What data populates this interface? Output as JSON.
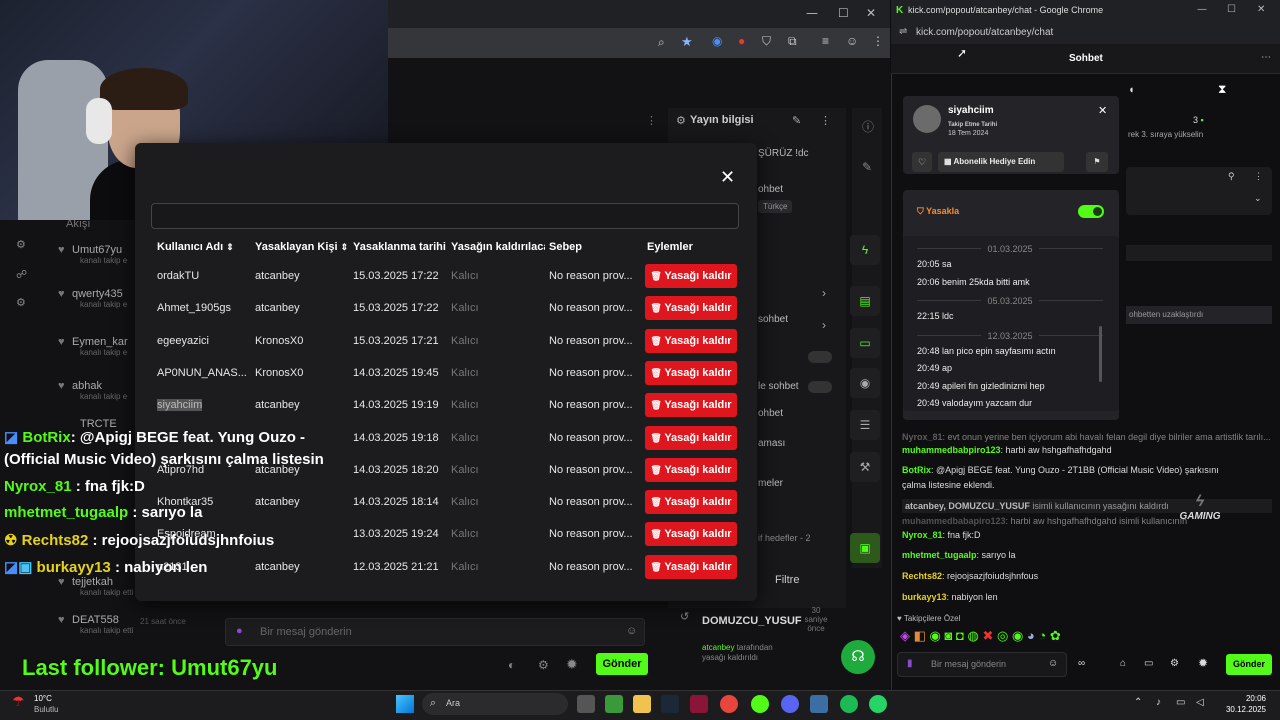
{
  "left_browser": {
    "window_controls": [
      "—",
      "☐",
      "✕"
    ]
  },
  "left_sidebar": {
    "heading": "Akışı",
    "items": [
      {
        "name": "Umut67yu",
        "sub": "kanalı takip e"
      },
      {
        "name": "qwerty435",
        "sub": "kanalı takip e"
      },
      {
        "name": "Eymen_kar",
        "sub": "kanalı takip e"
      },
      {
        "name": "abhak",
        "sub": "kanalı takip e"
      },
      {
        "name": "TRCTE",
        "sub": ""
      },
      {
        "name": "tejjetkah",
        "sub": "kanalı takip etti"
      },
      {
        "name": "DEAT558",
        "sub": "kanalı takip etti"
      }
    ],
    "deat_time": "21 saat önce"
  },
  "stream_info": {
    "heading": "Yayın bilgisi",
    "title_fragment": "ŞÜRÜZ !dc",
    "category_fragment": "ohbet",
    "language": "Türkçe",
    "items": [
      "sohbet",
      "le sohbet",
      "ohbet",
      "aması",
      "meler"
    ],
    "hedefler": "if hedefler - 2",
    "filter_label": "Filtre",
    "promo_user": "DOMUZCU_YUSUF",
    "promo_time": "30 saniye önce",
    "promo_text_prefix": "atcanbey",
    "promo_text": "tarafından yasağı kaldırıldı"
  },
  "bottom_chat": {
    "placeholder": "Bir mesaj gönderin",
    "send_label": "Gönder"
  },
  "ban_modal": {
    "columns": [
      "Kullanıcı Adı",
      "Yasaklayan Kişi",
      "Yasaklanma tarihi",
      "Yasağın kaldırılacağı",
      "Sebep",
      "Eylemler"
    ],
    "unban_label": "Yasağı kaldır",
    "rows": [
      {
        "user": "ordakTU",
        "by": "atcanbey",
        "date": "15.03.2025 17:22",
        "until": "Kalıcı",
        "reason": "No reason prov..."
      },
      {
        "user": "Ahmet_1905gs",
        "by": "atcanbey",
        "date": "15.03.2025 17:22",
        "until": "Kalıcı",
        "reason": "No reason prov..."
      },
      {
        "user": "egeeyazici",
        "by": "KronosX0",
        "date": "15.03.2025 17:21",
        "until": "Kalıcı",
        "reason": "No reason prov..."
      },
      {
        "user": "AP0NUN_ANAS...",
        "by": "KronosX0",
        "date": "14.03.2025 19:45",
        "until": "Kalıcı",
        "reason": "No reason prov..."
      },
      {
        "user": "siyahciim",
        "by": "atcanbey",
        "date": "14.03.2025 19:19",
        "until": "Kalıcı",
        "reason": "No reason prov..."
      },
      {
        "user": "",
        "by": "",
        "date": "14.03.2025 19:18",
        "until": "Kalıcı",
        "reason": "No reason prov..."
      },
      {
        "user": "Atipro7hd",
        "by": "atcanbey",
        "date": "14.03.2025 18:20",
        "until": "Kalıcı",
        "reason": "No reason prov..."
      },
      {
        "user": "Khontkar35",
        "by": "atcanbey",
        "date": "14.03.2025 18:14",
        "until": "Kalıcı",
        "reason": "No reason prov..."
      },
      {
        "user": "Espoidream",
        "by": "",
        "date": "13.03.2025 19:24",
        "until": "Kalıcı",
        "reason": "No reason prov..."
      },
      {
        "user": "n2131",
        "by": "atcanbey",
        "date": "12.03.2025 21:21",
        "until": "Kalıcı",
        "reason": "No reason prov..."
      }
    ]
  },
  "overlay_chat": [
    {
      "user": "BotRix",
      "text": ": @Apigj BEGE feat. Yung Ouzo -"
    },
    {
      "user": "",
      "text": "(Official Music Video) şarkısını çalma listesin"
    },
    {
      "user": "Nyrox_81",
      "text": ": fna fjk:D"
    },
    {
      "user": "mhetmet_tugaalp",
      "text": ": sarıyo la"
    },
    {
      "user": "Rechts82",
      "text": ": rejoojsazjfoiudsjhnfoius"
    },
    {
      "user": "burkayy13",
      "text": ": nabiyon len"
    }
  ],
  "last_follower": "Last follower: Umut67yu",
  "right_browser": {
    "title": "kick.com/popout/atcanbey/chat - Google Chrome",
    "url": "kick.com/popout/atcanbey/chat",
    "chat_title": "Sohbet",
    "behind_count": "3",
    "behind_text": "rek 3. sıraya yükselin",
    "behind_ban_note": "ohbetten uzaklaştırdı"
  },
  "user_card": {
    "username": "siyahciim",
    "follow_label": "Takip Etme Tarihi",
    "follow_date": "18 Tem 2024",
    "gift_label": "Abonelik Hediye Edin",
    "ban_label": "Yasakla",
    "history": [
      {
        "type": "date",
        "text": "01.03.2025"
      },
      {
        "type": "msg",
        "time": "20:05",
        "text": "sa"
      },
      {
        "type": "msg",
        "time": "20:06",
        "text": "benim 25kda bitti amk"
      },
      {
        "type": "date",
        "text": "05.03.2025"
      },
      {
        "type": "msg",
        "time": "22:15",
        "text": "ldc"
      },
      {
        "type": "date",
        "text": "12.03.2025"
      },
      {
        "type": "msg",
        "time": "20:48",
        "text": "lan pico epin sayfasımı actın"
      },
      {
        "type": "msg",
        "time": "20:49",
        "text": "ap"
      },
      {
        "type": "msg",
        "time": "20:49",
        "text": "apileri fin gizledinizmi hep"
      },
      {
        "type": "msg",
        "time": "20:49",
        "text": "valodayım yazcam dur"
      }
    ]
  },
  "right_chat": [
    {
      "kind": "dim",
      "user": "Nyrox_81",
      "text": ": evt onun yerine ben içiyorum abi havalı felan degil diye bilriler ama artistlik tarılı..."
    },
    {
      "kind": "normal",
      "user": "muhammedbabpiro123",
      "text": ": harbi aw hshgafhafhdgahd"
    },
    {
      "kind": "normal",
      "user": "BotRix",
      "text": ": @Apigj BEGE feat. Yung Ouzo - 2T1BB (Official Music Video) şarkısını"
    },
    {
      "kind": "cont",
      "user": "",
      "text": "çalma listesine eklendi."
    },
    {
      "kind": "system",
      "user": "atcanbey, DOMUZCU_YUSUF",
      "text": " isimli kullanıcının yasağını kaldırdı"
    },
    {
      "kind": "dim",
      "user": "muhammedbabapiro123",
      "text": ": harbi aw hshgafhafhdgahd isimli kullanıcının"
    },
    {
      "kind": "normal",
      "user": "Nyrox_81",
      "text": ": fna fjk:D"
    },
    {
      "kind": "normal",
      "user": "mhetmet_tugaalp",
      "text": ": sarıyo la"
    },
    {
      "kind": "normal",
      "user": "Rechts82",
      "text": ": rejoojsazjfoiudsjhnfous"
    },
    {
      "kind": "normal",
      "user": "burkayy13",
      "text": ": nabiyon len"
    }
  ],
  "emote_bar": {
    "label": "Takipçilere Özel"
  },
  "chat_input": {
    "placeholder": "Bir mesaj gönderin",
    "send_label": "Gönder"
  },
  "watermark": "GAMING",
  "taskbar": {
    "weather_temp": "10°C",
    "weather_desc": "Bulutlu",
    "search_placeholder": "Ara",
    "time": "20:06",
    "date": "30.12.2025"
  },
  "colors": {
    "accent": "#53fc18",
    "danger": "#e0161e"
  }
}
